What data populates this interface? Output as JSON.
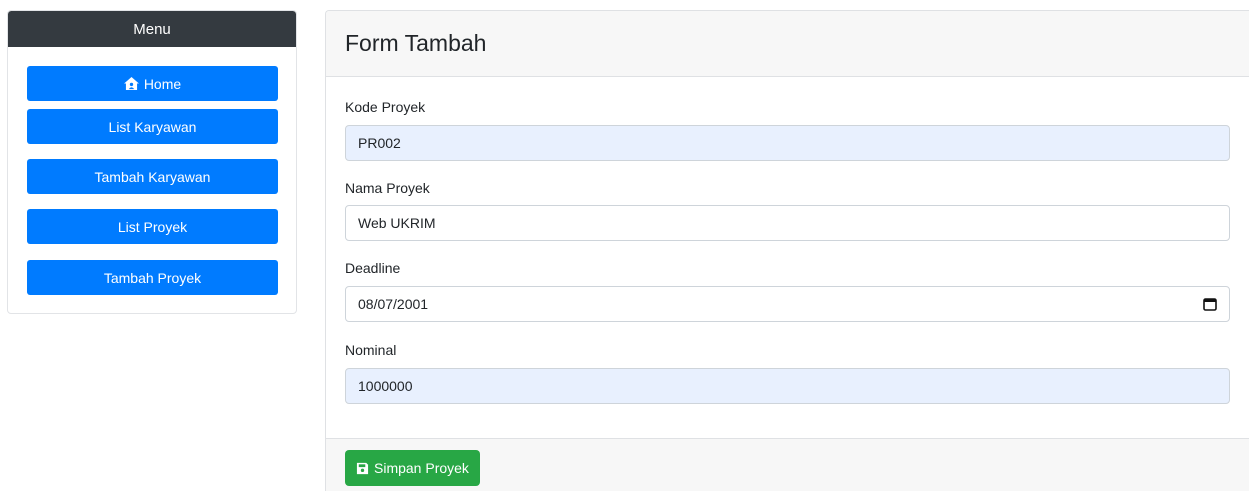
{
  "sidebar": {
    "header": "Menu",
    "items": [
      {
        "label": "Home",
        "icon": "house-user-icon"
      },
      {
        "label": "List Karyawan"
      },
      {
        "label": "Tambah Karyawan"
      },
      {
        "label": "List Proyek"
      },
      {
        "label": "Tambah Proyek"
      }
    ]
  },
  "form": {
    "title": "Form Tambah",
    "fields": {
      "kode": {
        "label": "Kode Proyek",
        "value": "PR002"
      },
      "nama": {
        "label": "Nama Proyek",
        "value": "Web UKRIM"
      },
      "deadline": {
        "label": "Deadline",
        "value": "08/07/2001"
      },
      "nominal": {
        "label": "Nominal",
        "value": "1000000"
      }
    },
    "submit_label": "Simpan Proyek",
    "submit_icon": "save-icon"
  },
  "colors": {
    "primary": "#007bff",
    "success": "#28a745",
    "dark": "#343a40",
    "autofill": "#e8f0fe"
  }
}
